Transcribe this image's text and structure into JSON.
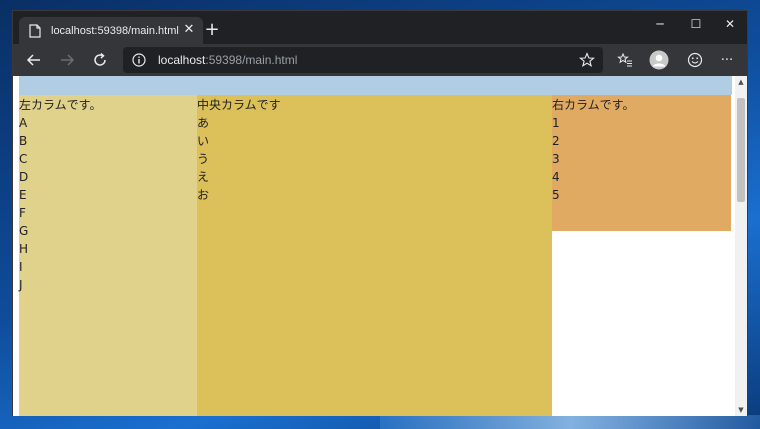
{
  "browser": {
    "tab": {
      "title": "localhost:59398/main.html",
      "favicon_icon": "page-icon",
      "close_label": "✕"
    },
    "new_tab_label": "+",
    "window_controls": {
      "minimize": "─",
      "maximize": "☐",
      "close": "✕"
    },
    "toolbar": {
      "back_icon": "back-arrow-icon",
      "forward_icon": "forward-arrow-icon",
      "refresh_icon": "refresh-icon",
      "favorites_icon": "favorites-icon",
      "profile_icon": "profile-avatar-icon",
      "feedback_icon": "smiley-icon",
      "more_label": "···"
    },
    "address": {
      "host": "localhost",
      "path": ":59398/main.html"
    }
  },
  "page": {
    "left": {
      "title": "左カラムです。",
      "items": [
        "A",
        "B",
        "C",
        "D",
        "E",
        "F",
        "G",
        "H",
        "I",
        "J"
      ]
    },
    "center": {
      "title": "中央カラムです",
      "items": [
        "あ",
        "い",
        "う",
        "え",
        "お"
      ]
    },
    "right": {
      "title": "右カラムです。",
      "items": [
        "1",
        "2",
        "3",
        "4",
        "5"
      ]
    }
  },
  "colors": {
    "header": "#b0cde4",
    "left": "#e0d28a",
    "center": "#dcc05a",
    "right": "#e0aa63"
  },
  "scrollbar": {
    "up": "▲",
    "down": "▼"
  }
}
